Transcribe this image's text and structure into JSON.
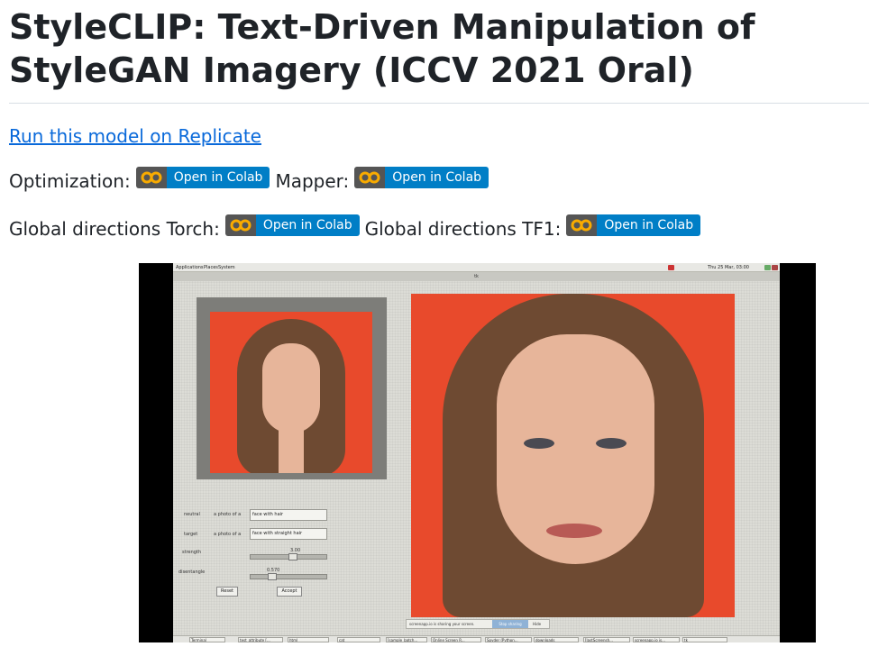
{
  "page": {
    "title": "StyleCLIP: Text-Driven Manipulation of StyleGAN Imagery (ICCV 2021 Oral)",
    "replicate_link": "Run this model on Replicate"
  },
  "badges": {
    "button_text": "Open in Colab",
    "logo_text": "CO",
    "row1": {
      "label_a": "Optimization:",
      "label_b": "Mapper:"
    },
    "row2": {
      "label_a": "Global directions Torch:",
      "label_b": "Global directions TF1:"
    }
  },
  "colors": {
    "link": "#0969da",
    "badge_left": "#555555",
    "badge_right": "#007ec6",
    "colab_orange": "#f9ab00",
    "photo_background": "#e84a2c"
  },
  "video": {
    "top_panel": {
      "menus": [
        "Applications",
        "Places",
        "System"
      ],
      "clock": "Thu 25 Mar, 03:00"
    },
    "window_title": "tk",
    "controls": {
      "neutral_label": "neutral",
      "target_label": "target",
      "prompt_prefix": "a photo of a",
      "neutral_value": "face with hair",
      "target_value": "face with straight hair",
      "strength_label": "strength",
      "strength_value": "3.00",
      "disentangle_label": "disentangle",
      "disentangle_value": "0.570",
      "reset_label": "Reset",
      "accept_label": "Accept"
    },
    "share_bar": {
      "text": "screenapp.io is sharing your screen.",
      "stop_label": "Stop sharing",
      "hide_label": "Hide"
    },
    "taskbar": [
      "Terminal",
      "test_attribute [...",
      "html",
      "cat",
      "[sample_batch...",
      "Online Screen R...",
      "Spyder (Python...",
      "downloads",
      "[lastScreensh...",
      "screenapp.io is...",
      "tk"
    ]
  }
}
